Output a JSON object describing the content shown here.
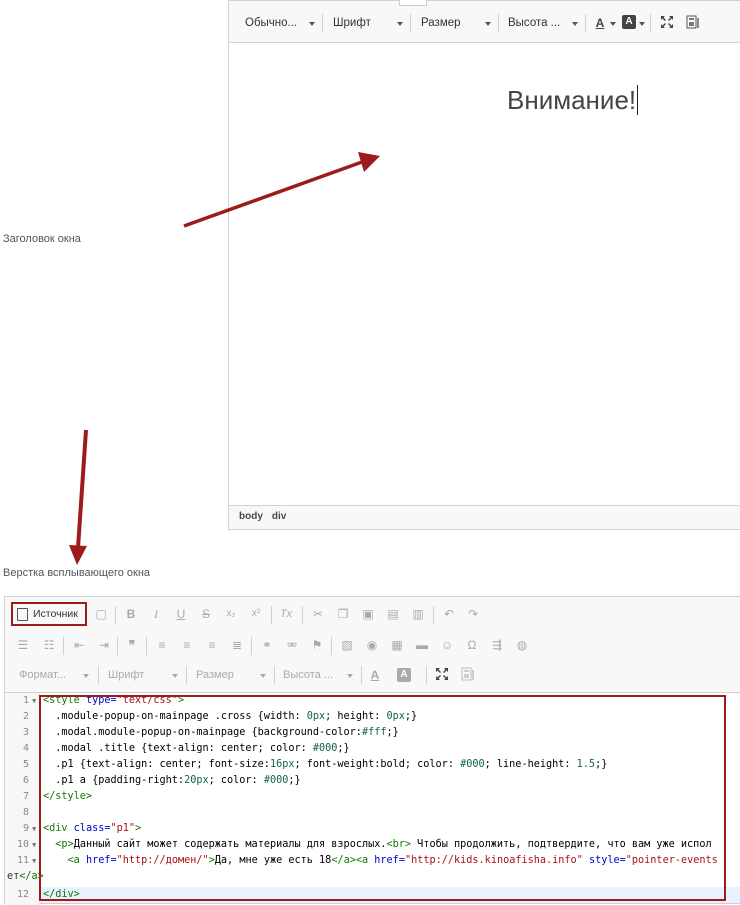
{
  "top_editor": {
    "toolbar": {
      "format_combo": "Обычно...",
      "font_combo": "Шрифт",
      "size_combo": "Размер",
      "line_height_combo": "Высота ...",
      "text_color_glyph": "A",
      "bg_color_glyph": "A"
    },
    "content": {
      "heading": "Внимание!"
    },
    "path": [
      "body",
      "div"
    ]
  },
  "labels": {
    "window_title": "Заголовок окна",
    "popup_markup": "Верстка всплывающего окна"
  },
  "bottom_editor": {
    "toolbar": {
      "source_button": "Источник",
      "format_combo": "Формат...",
      "font_combo": "Шрифт",
      "size_combo": "Размер",
      "line_height_combo": "Высота ...",
      "bold_glyph": "B",
      "italic_glyph": "I",
      "underline_glyph": "U",
      "strike_glyph": "S",
      "subscript_glyph": "x₂",
      "superscript_glyph": "x²",
      "clear_format_glyph": "Tx",
      "quote_glyph": "❞",
      "omega_glyph": "Ω",
      "text_color_glyph": "A",
      "bg_color_glyph": "A"
    },
    "code_lines": [
      {
        "n": "1",
        "fold": true
      },
      {
        "n": "2",
        "fold": false
      },
      {
        "n": "3",
        "fold": false
      },
      {
        "n": "4",
        "fold": false
      },
      {
        "n": "5",
        "fold": false
      },
      {
        "n": "6",
        "fold": false
      },
      {
        "n": "7",
        "fold": false
      },
      {
        "n": "8",
        "fold": false
      },
      {
        "n": "9",
        "fold": true
      },
      {
        "n": "10",
        "fold": true
      },
      {
        "n": "11",
        "fold": true
      },
      {
        "n": "12",
        "fold": false
      }
    ],
    "code": {
      "l1_open": "<style ",
      "l1_attr": "type=",
      "l1_val": "\"text/css\"",
      "l1_close": ">",
      "l2_a": "  .module-popup-on-mainpage .cross {width: ",
      "l2_n1": "0px",
      "l2_b": "; height: ",
      "l2_n2": "0px",
      "l2_c": ";}",
      "l3_a": "  .modal.module-popup-on-mainpage {background-color:",
      "l3_n": "#fff",
      "l3_b": ";}",
      "l4_a": "  .modal .title {text-align: center; color: ",
      "l4_n": "#000",
      "l4_b": ";}",
      "l5_a": "  .p1 {text-align: center; font-size:",
      "l5_n1": "16px",
      "l5_b": "; font-weight:bold; color: ",
      "l5_n2": "#000",
      "l5_c": "; line-height: ",
      "l5_n3": "1.5",
      "l5_d": ";}",
      "l6_a": "  .p1 a {padding-right:",
      "l6_n1": "20px",
      "l6_b": "; color: ",
      "l6_n2": "#000",
      "l6_c": ";}",
      "l7": "</style>",
      "l9_open": "<div ",
      "l9_attr": "class=",
      "l9_val": "\"p1\"",
      "l9_close": ">",
      "l10_indent": "  ",
      "l10_tag": "<p>",
      "l10_text": "Данный сайт может содержать материалы для взрослых.",
      "l10_br": "<br>",
      "l10_text2": " Чтобы продолжить, подтвердите, что вам уже испол",
      "l11_indent": "    ",
      "l11_a1": "<a ",
      "l11_href1": "href=",
      "l11_val1": "\"http://домен/\"",
      "l11_gt": ">",
      "l11_text1": "Да, мне уже есть 18",
      "l11_close1": "</a>",
      "l11_a2": "<a ",
      "l11_href2": "href=",
      "l11_val2": "\"http://kids.kinoafisha.info\"",
      "l11_style": " style=",
      "l11_val3": "\"pointer-events",
      "l11b_text": "ет",
      "l11b_close": "</a>",
      "l12": "</div>"
    }
  },
  "colors": {
    "annotation_red": "#9e1b1b",
    "tag_green": "#117700",
    "attr_blue": "#0000cc",
    "string_red": "#aa1111"
  }
}
